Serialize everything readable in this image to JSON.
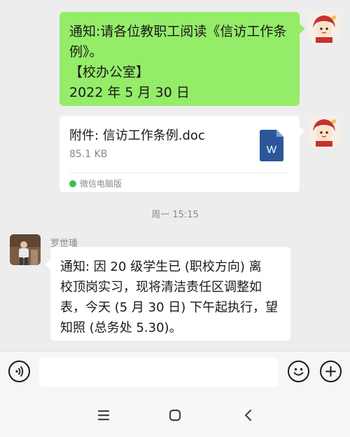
{
  "messages": {
    "sent_text": {
      "lines": [
        "通知:请各位教职工阅读《信访工作条",
        "例》。",
        "【校办公室】",
        "2022 年 5 月 30 日"
      ]
    },
    "sent_file": {
      "file_name": "附件: 信访工作条例.doc",
      "file_size": "85.1 KB",
      "source": "微信电脑版",
      "file_type_letter": "W"
    },
    "timestamp": "周一 15:15",
    "received": {
      "sender": "罗世璠",
      "lines": [
        "通知: 因 20 级学生已 (职校方向) 离",
        "校顶岗实习，现将清洁责任区调整如",
        "表，今天 (5 月 30 日) 下午起执行，望",
        "知照 (总务处 5.30)。"
      ]
    }
  },
  "colors": {
    "sent_bubble": "#95ec69",
    "received_bubble": "#ffffff",
    "background": "#ededed",
    "word_icon": "#2b579a"
  },
  "icons": {
    "voice": "voice-icon",
    "emoji": "emoji-icon",
    "plus": "plus-icon",
    "nav_menu": "nav-menu-icon",
    "nav_home": "nav-home-icon",
    "nav_back": "nav-back-icon"
  }
}
